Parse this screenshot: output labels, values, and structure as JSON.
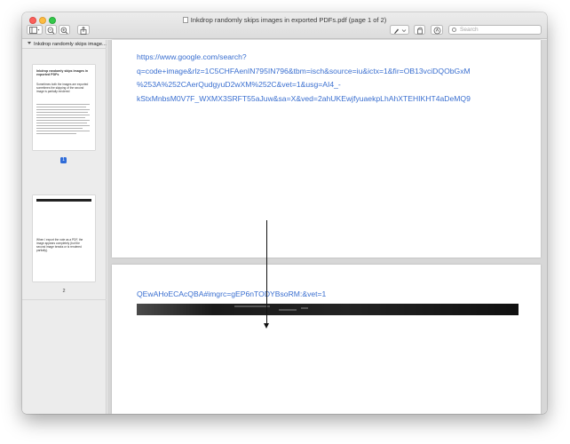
{
  "window": {
    "title": "Inkdrop randomly skips images in exported PDFs.pdf (page 1 of 2)"
  },
  "toolbar": {
    "sidebar_toggle_icon": "sidebar-icon",
    "zoom_out_icon": "zoom-out-icon",
    "zoom_in_icon": "zoom-in-icon",
    "share_icon": "share-icon",
    "markup_icon": "pen-icon",
    "rotate_icon": "rotate-icon",
    "annotate_icon": "markup-circle-icon",
    "search_placeholder": "Search"
  },
  "sidebar": {
    "header": "Inkdrop randomly skips image...",
    "thumbnails": [
      {
        "page_label": "1",
        "selected": true,
        "snippet_title": "Inkdrop randomly skips images in exported PDFs",
        "snippet_body": "Sometimes both the images are exported sometimes the skipping of the second image is partially rendered"
      },
      {
        "page_label": "2",
        "selected": false,
        "snippet_body": "When I export the note as a PDF, the image appears completely (but the second image breaks or is rendered partially)."
      }
    ]
  },
  "document": {
    "page1": {
      "url_lines": [
        {
          "text": "https://www.google.com/search?",
          "italic": false
        },
        {
          "text": "q=code+image&rlz=1C5CHFAenIN795IN796&tbm=isch&source=iu&ictx=1&fir=OB13vciDQObGxM",
          "italic": false
        },
        {
          "text": "%253A%252CAerQudgyuD2wXM%252C&vet=1&usg=AI4_-",
          "italic": false
        },
        {
          "text": "kStxMnbsM0V7F_WXMX3SRFT55aJuw&sa=X&ved=2ahUKEwjfyuaekpLhAhXTEHIKHT4aDeMQ9",
          "italic": false
        }
      ]
    },
    "page2": {
      "url_text": "QEwAHoECAcQBA#imgrc=gEP6nTODYBsoRM:&vet=1"
    }
  },
  "colors": {
    "link": "#3a6fd0",
    "accent": "#2f6cd8",
    "close": "#fc605b",
    "minimize": "#fdbc40",
    "maximize": "#34c84a"
  }
}
